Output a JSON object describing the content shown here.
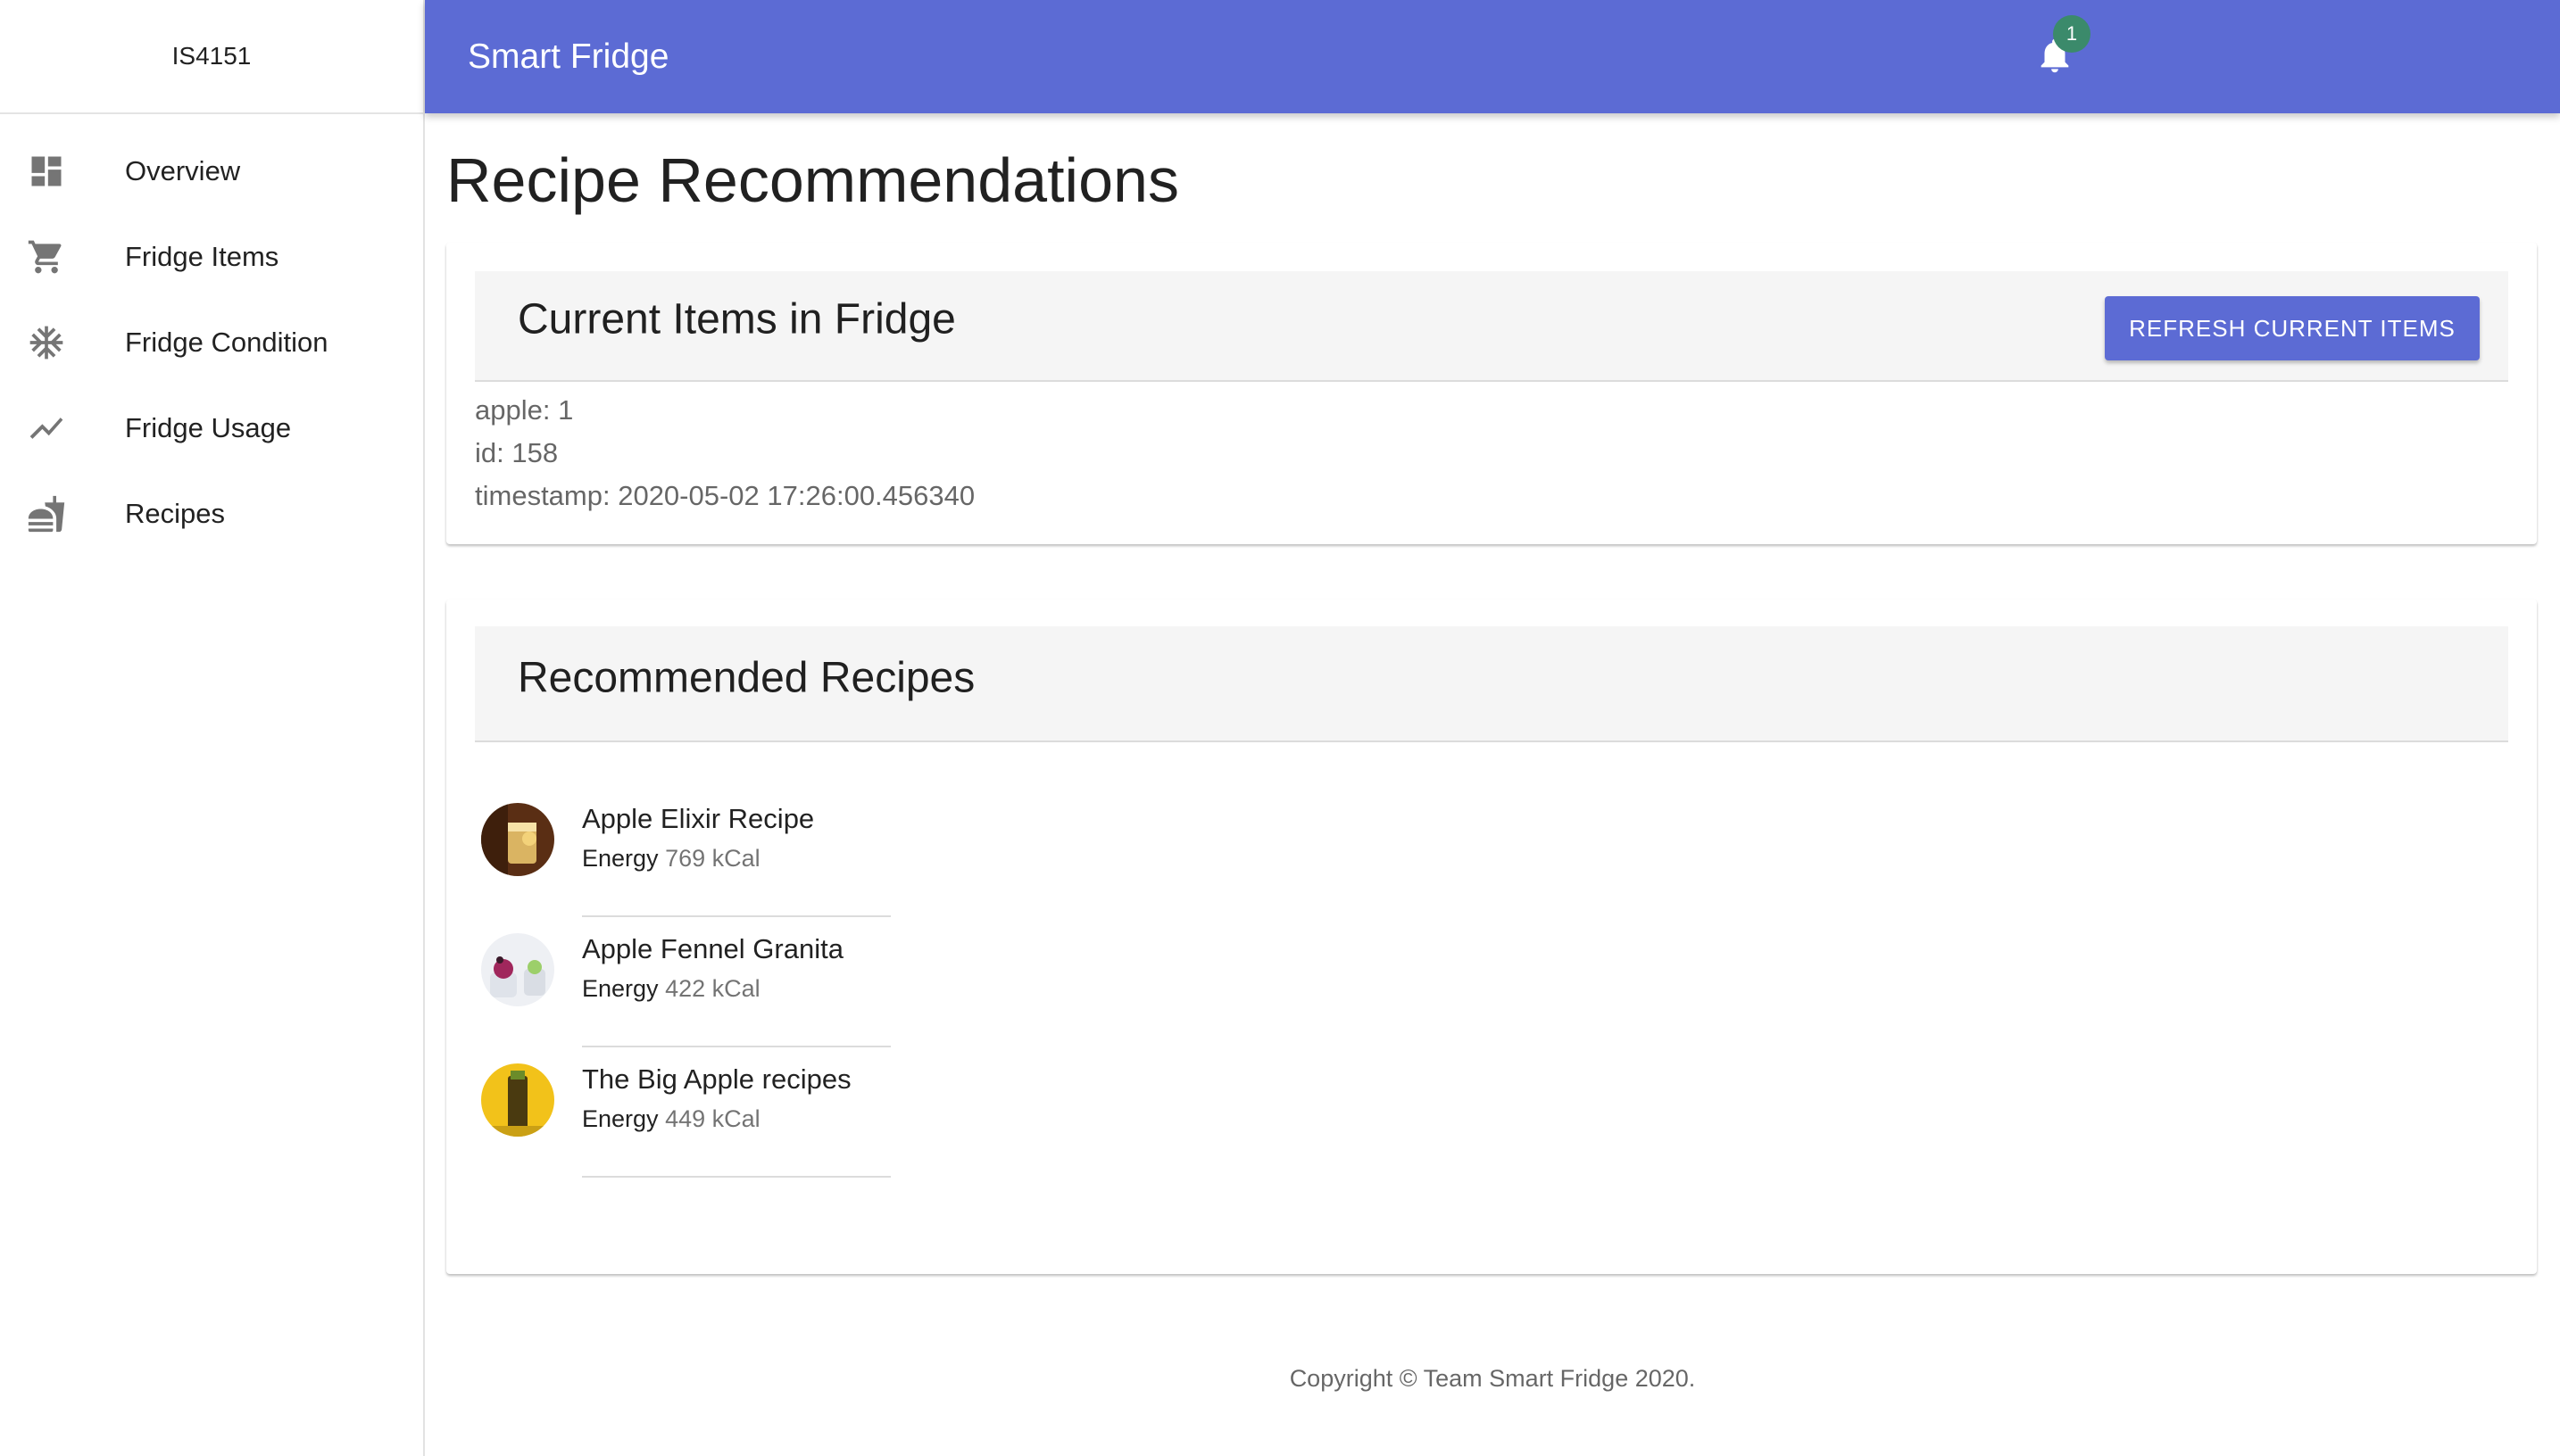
{
  "sidebar": {
    "brand": "IS4151",
    "items": [
      {
        "label": "Overview",
        "icon": "dashboard-icon"
      },
      {
        "label": "Fridge Items",
        "icon": "cart-icon"
      },
      {
        "label": "Fridge Condition",
        "icon": "snowflake-icon"
      },
      {
        "label": "Fridge Usage",
        "icon": "trending-icon"
      },
      {
        "label": "Recipes",
        "icon": "fastfood-icon"
      }
    ]
  },
  "appbar": {
    "title": "Smart Fridge",
    "notification_count": "1"
  },
  "main": {
    "page_title": "Recipe Recommendations",
    "current_items": {
      "title": "Current Items in Fridge",
      "refresh_label": "REFRESH CURRENT ITEMS",
      "lines": [
        "apple: 1",
        "id: 158",
        "timestamp: 2020-05-02 17:26:00.456340"
      ]
    },
    "recommended": {
      "title": "Recommended Recipes",
      "energy_label": "Energy",
      "recipes": [
        {
          "name": "Apple Elixir Recipe",
          "energy": "769 kCal"
        },
        {
          "name": "Apple Fennel Granita",
          "energy": "422 kCal"
        },
        {
          "name": "The Big Apple recipes",
          "energy": "449 kCal"
        }
      ]
    }
  },
  "footer": {
    "text": "Copyright © Team Smart Fridge 2020."
  },
  "colors": {
    "primary": "#5c6bd4",
    "badge": "#3b8a6b"
  }
}
